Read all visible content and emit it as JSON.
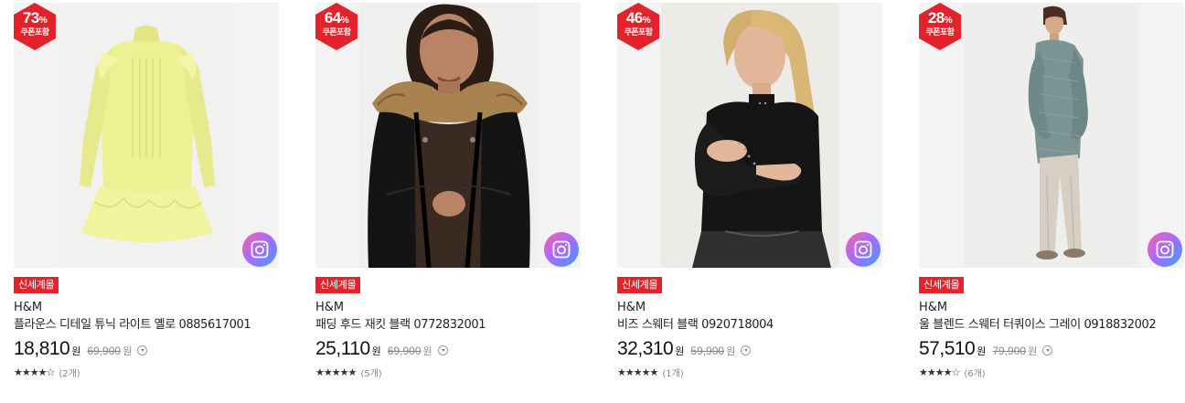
{
  "products": [
    {
      "discount": "73",
      "discount_unit": "%",
      "coupon_label": "쿠폰포함",
      "tag": "신세계몰",
      "brand": "H&M",
      "name": "플라운스 디테일 튜닉 라이트 옐로 0885617001",
      "price": "18,810",
      "currency": "원",
      "original_price": "69,900",
      "stars": "★★★★☆",
      "rating": 4.5,
      "review_count": "(2개)",
      "image": "light-yellow-ruffle-tunic-dress"
    },
    {
      "discount": "64",
      "discount_unit": "%",
      "coupon_label": "쿠폰포함",
      "tag": "신세계몰",
      "brand": "H&M",
      "name": "패딩 후드 재킷 블랙 0772832001",
      "price": "25,110",
      "currency": "원",
      "original_price": "69,900",
      "stars": "★★★★★",
      "rating": 5,
      "review_count": "(5개)",
      "image": "model-black-padded-fur-hood-jacket"
    },
    {
      "discount": "46",
      "discount_unit": "%",
      "coupon_label": "쿠폰포함",
      "tag": "신세계몰",
      "brand": "H&M",
      "name": "비즈 스웨터 블랙 0920718004",
      "price": "32,310",
      "currency": "원",
      "original_price": "59,900",
      "stars": "★★★★★",
      "rating": 5,
      "review_count": "(1개)",
      "image": "model-black-beaded-sweater"
    },
    {
      "discount": "28",
      "discount_unit": "%",
      "coupon_label": "쿠폰포함",
      "tag": "신세계몰",
      "brand": "H&M",
      "name": "울 블렌드 스웨터 터쿼이스 그레이 0918832002",
      "price": "57,510",
      "currency": "원",
      "original_price": "79,900",
      "stars": "★★★★☆",
      "rating": 4.5,
      "review_count": "(6개)",
      "image": "model-turquoise-grey-wool-sweater"
    }
  ],
  "colors": {
    "badge": "#e3222b",
    "tag": "#e3222b",
    "lens_gradient": [
      "#ff5ea8",
      "#a36bff",
      "#3aa0ff"
    ]
  },
  "icons": {
    "lens": "camera-lens-search-icon",
    "info": "chevron-down-circle-icon"
  }
}
